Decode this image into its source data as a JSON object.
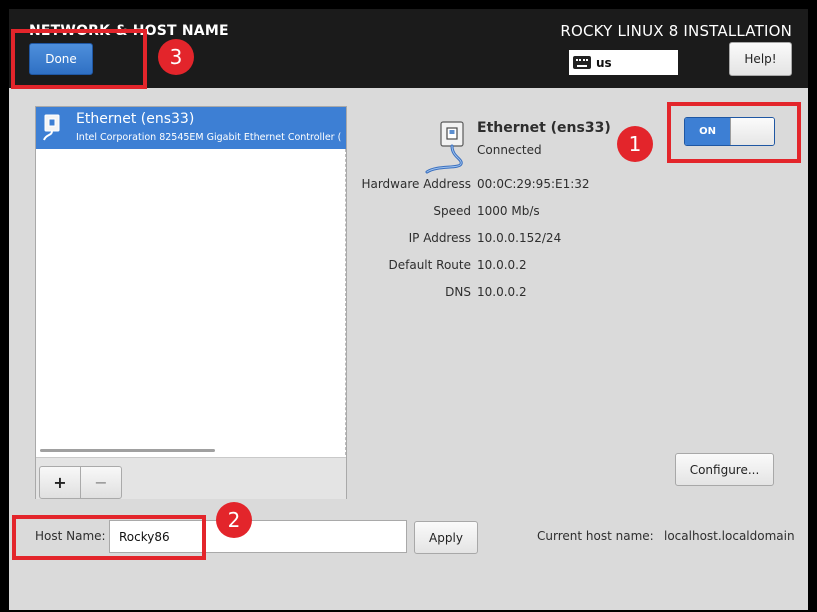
{
  "header": {
    "title": "NETWORK & HOST NAME",
    "product": "ROCKY LINUX 8 INSTALLATION",
    "done_label": "Done",
    "help_label": "Help!",
    "keyboard_layout": "us"
  },
  "devices": [
    {
      "name": "Ethernet (ens33)",
      "description": "Intel Corporation 82545EM Gigabit Ethernet Controller (",
      "icon": "ethernet-icon",
      "selected": true
    }
  ],
  "device_controls": {
    "add_label": "+",
    "remove_label": "−"
  },
  "details": {
    "name": "Ethernet (ens33)",
    "status": "Connected",
    "fields": [
      {
        "label": "Hardware Address",
        "value": "00:0C:29:95:E1:32"
      },
      {
        "label": "Speed",
        "value": "1000 Mb/s"
      },
      {
        "label": "IP Address",
        "value": "10.0.0.152/24"
      },
      {
        "label": "Default Route",
        "value": "10.0.0.2"
      },
      {
        "label": "DNS",
        "value": "10.0.0.2"
      }
    ],
    "toggle_label": "ON",
    "toggle_state": "on",
    "configure_label": "Configure..."
  },
  "hostname": {
    "label": "Host Name:",
    "value": "Rocky86",
    "apply_label": "Apply",
    "current_label": "Current host name:",
    "current_value": "localhost.localdomain"
  },
  "annotations": [
    "1",
    "2",
    "3"
  ],
  "colors": {
    "accent": "#3d7fd4",
    "header_bg": "#1b1b1b",
    "panel_bg": "#dadada",
    "annotation_red": "#e3252b"
  }
}
